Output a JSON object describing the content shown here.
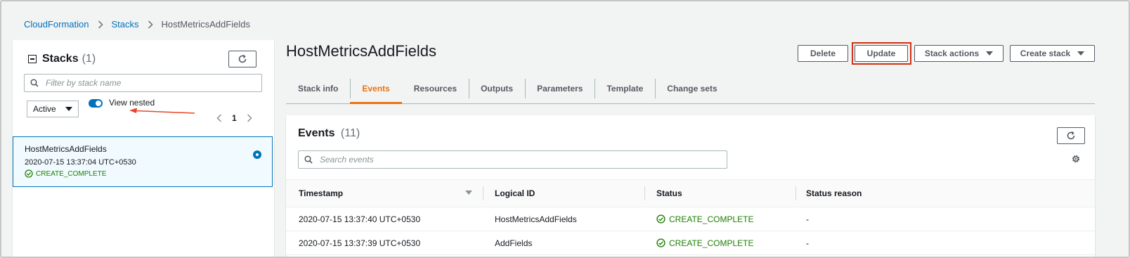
{
  "breadcrumb": {
    "items": [
      "CloudFormation",
      "Stacks"
    ],
    "current": "HostMetricsAddFields"
  },
  "stacks_panel": {
    "title": "Stacks",
    "count": "(1)",
    "search_placeholder": "Filter by stack name",
    "filter_value": "Active",
    "view_nested_label": "View nested",
    "view_nested_on": true,
    "page_number": "1",
    "stack": {
      "name": "HostMetricsAddFields",
      "timestamp": "2020-07-15 13:37:04 UTC+0530",
      "status": "CREATE_COMPLETE",
      "selected": true
    }
  },
  "page": {
    "title": "HostMetricsAddFields"
  },
  "actions": {
    "delete": "Delete",
    "update": "Update",
    "stack_actions": "Stack actions",
    "create_stack": "Create stack"
  },
  "tabs": [
    {
      "label": "Stack info",
      "active": false
    },
    {
      "label": "Events",
      "active": true
    },
    {
      "label": "Resources",
      "active": false
    },
    {
      "label": "Outputs",
      "active": false
    },
    {
      "label": "Parameters",
      "active": false
    },
    {
      "label": "Template",
      "active": false
    },
    {
      "label": "Change sets",
      "active": false
    }
  ],
  "events": {
    "title": "Events",
    "count": "(11)",
    "search_placeholder": "Search events",
    "columns": [
      "Timestamp",
      "Logical ID",
      "Status",
      "Status reason"
    ],
    "rows": [
      {
        "timestamp": "2020-07-15 13:37:40 UTC+0530",
        "logical_id": "HostMetricsAddFields",
        "status": "CREATE_COMPLETE",
        "reason": "-"
      },
      {
        "timestamp": "2020-07-15 13:37:39 UTC+0530",
        "logical_id": "AddFields",
        "status": "CREATE_COMPLETE",
        "reason": "-"
      }
    ]
  },
  "colors": {
    "link": "#0073bb",
    "active_tab": "#ec7211",
    "success": "#1d8102",
    "highlight": "#d13212"
  }
}
